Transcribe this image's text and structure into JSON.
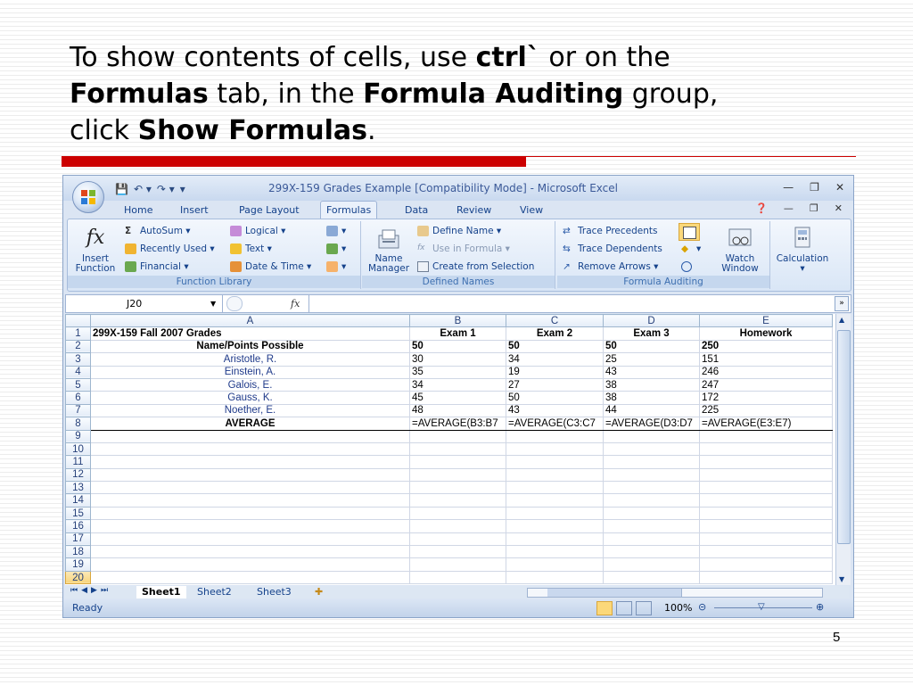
{
  "heading": {
    "p1": "To show contents of cells, use ",
    "b1": "ctrl`",
    "p2": " or on the ",
    "b2": "Formulas",
    "p3": " tab, in the ",
    "b3": "Formula Auditing",
    "p4": " group, click ",
    "b4": "Show Formulas",
    "p5": "."
  },
  "window": {
    "title": "299X-159 Grades Example  [Compatibility Mode] - Microsoft Excel"
  },
  "ribbon": {
    "tabs": [
      "Home",
      "Insert",
      "Page Layout",
      "Formulas",
      "Data",
      "Review",
      "View"
    ],
    "active_tab": "Formulas",
    "function_library": {
      "label": "Function Library",
      "insert_function": [
        "Insert",
        "Function"
      ],
      "autosum": "AutoSum",
      "recently_used": "Recently Used",
      "financial": "Financial",
      "logical": "Logical",
      "text": "Text",
      "date_time": "Date & Time"
    },
    "defined_names": {
      "label": "Defined Names",
      "name_manager": [
        "Name",
        "Manager"
      ],
      "define_name": "Define Name",
      "use_in_formula": "Use in Formula",
      "create_from_selection": "Create from Selection"
    },
    "formula_auditing": {
      "label": "Formula Auditing",
      "trace_precedents": "Trace Precedents",
      "trace_dependents": "Trace Dependents",
      "remove_arrows": "Remove Arrows",
      "watch_window": [
        "Watch",
        "Window"
      ]
    },
    "calculation": "Calculation"
  },
  "formula_bar": {
    "name_box": "J20",
    "fx": "fx",
    "content": ""
  },
  "sheet": {
    "columns": [
      "A",
      "B",
      "C",
      "D",
      "E"
    ],
    "rows": [
      [
        "299X-159 Fall 2007 Grades",
        "Exam 1",
        "Exam 2",
        "Exam 3",
        "Homework"
      ],
      [
        "Name/Points Possible",
        "50",
        "50",
        "50",
        "250"
      ],
      [
        "Aristotle, R.",
        "30",
        "34",
        "25",
        "151"
      ],
      [
        "Einstein, A.",
        "35",
        "19",
        "43",
        "246"
      ],
      [
        "Galois, E.",
        "34",
        "27",
        "38",
        "247"
      ],
      [
        "Gauss, K.",
        "45",
        "50",
        "38",
        "172"
      ],
      [
        "Noether, E.",
        "48",
        "43",
        "44",
        "225"
      ],
      [
        "AVERAGE",
        "=AVERAGE(B3:B7",
        "=AVERAGE(C3:C7",
        "=AVERAGE(D3:D7",
        "=AVERAGE(E3:E7)"
      ]
    ],
    "total_rows": 20,
    "selected_row": 20
  },
  "sheet_tabs": [
    "Sheet1",
    "Sheet2",
    "Sheet3"
  ],
  "status": {
    "ready": "Ready",
    "zoom": "100%"
  },
  "slide_number": "5"
}
